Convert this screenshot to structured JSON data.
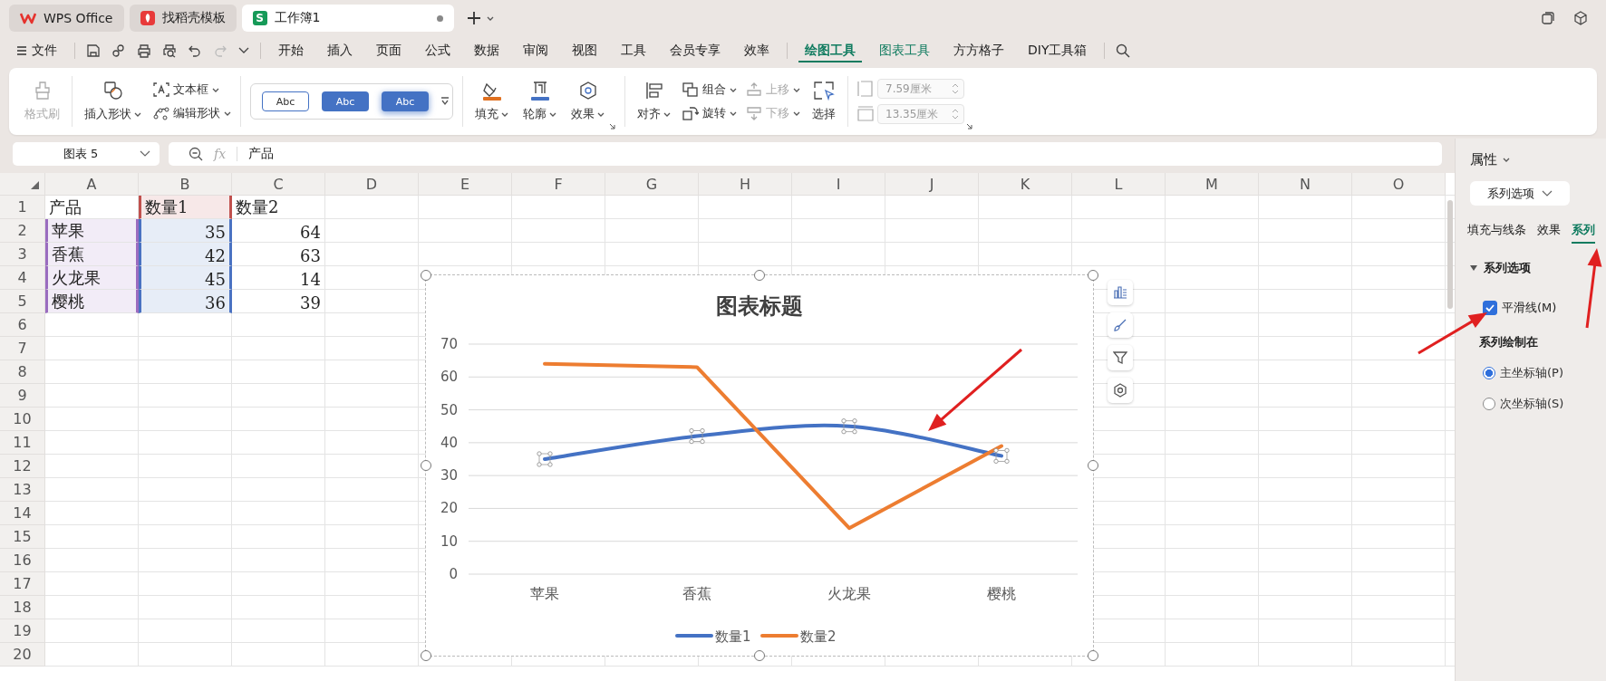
{
  "tabs": [
    {
      "label": "WPS Office",
      "kind": "wps",
      "selected": false,
      "modified": false
    },
    {
      "label": "找稻壳模板",
      "kind": "docer",
      "selected": false,
      "modified": false
    },
    {
      "label": "工作簿1",
      "kind": "sheet",
      "badge": "S",
      "selected": true,
      "modified": true
    }
  ],
  "menu": {
    "file": "文件",
    "items": [
      {
        "label": "开始",
        "selected": false,
        "contextual": false
      },
      {
        "label": "插入",
        "selected": false,
        "contextual": false
      },
      {
        "label": "页面",
        "selected": false,
        "contextual": false
      },
      {
        "label": "公式",
        "selected": false,
        "contextual": false
      },
      {
        "label": "数据",
        "selected": false,
        "contextual": false
      },
      {
        "label": "审阅",
        "selected": false,
        "contextual": false
      },
      {
        "label": "视图",
        "selected": false,
        "contextual": false
      },
      {
        "label": "工具",
        "selected": false,
        "contextual": false
      },
      {
        "label": "会员专享",
        "selected": false,
        "contextual": false
      },
      {
        "label": "效率",
        "selected": false,
        "contextual": false
      },
      {
        "label": "绘图工具",
        "selected": true,
        "contextual": true
      },
      {
        "label": "图表工具",
        "selected": false,
        "contextual": true
      },
      {
        "label": "方方格子",
        "selected": false,
        "contextual": false
      },
      {
        "label": "DIY工具箱",
        "selected": false,
        "contextual": false
      }
    ]
  },
  "ribbon": {
    "format_painter": {
      "label": "格式刷",
      "disabled": true
    },
    "insert_shape": "插入形状",
    "text_box": "文本框",
    "edit_shape": "编辑形状",
    "style_samples": [
      {
        "label": "Abc",
        "kind": "outline"
      },
      {
        "label": "Abc",
        "kind": "filled"
      },
      {
        "label": "Abc",
        "kind": "glow"
      }
    ],
    "fill": "填充",
    "outline": "轮廓",
    "effect": "效果",
    "align": "对齐",
    "group": "组合",
    "rotate": "旋转",
    "bring_forward": {
      "label": "上移",
      "disabled": true
    },
    "send_backward": {
      "label": "下移",
      "disabled": true
    },
    "select": "选择",
    "height": {
      "value": "7.59厘米",
      "disabled": true
    },
    "width": {
      "value": "13.35厘米",
      "disabled": true
    }
  },
  "formula_bar": {
    "name_box": "图表 5",
    "fx": "fx",
    "formula": "产品"
  },
  "sheet": {
    "columns": [
      "A",
      "B",
      "C",
      "D",
      "E",
      "F",
      "G",
      "H",
      "I",
      "J",
      "K",
      "L",
      "M",
      "N",
      "O"
    ],
    "rows": [
      {
        "label": "1",
        "cells": [
          {
            "text": "产品",
            "kind": "text"
          },
          {
            "text": "数量1",
            "kind": "text",
            "color": "#c0504d"
          },
          {
            "text": "数量2",
            "kind": "text"
          }
        ]
      },
      {
        "label": "2",
        "cells": [
          {
            "text": "苹果",
            "kind": "text",
            "color": "#9a6cbf"
          },
          {
            "text": "35",
            "kind": "number",
            "color": "#4a72c2"
          },
          {
            "text": "64",
            "kind": "number"
          }
        ]
      },
      {
        "label": "3",
        "cells": [
          {
            "text": "香蕉",
            "kind": "text",
            "color": "#9a6cbf"
          },
          {
            "text": "42",
            "kind": "number",
            "color": "#4a72c2"
          },
          {
            "text": "63",
            "kind": "number"
          }
        ]
      },
      {
        "label": "4",
        "cells": [
          {
            "text": "火龙果",
            "kind": "text",
            "color": "#9a6cbf"
          },
          {
            "text": "45",
            "kind": "number",
            "color": "#4a72c2"
          },
          {
            "text": "14",
            "kind": "number"
          }
        ]
      },
      {
        "label": "5",
        "cells": [
          {
            "text": "樱桃",
            "kind": "text",
            "color": "#9a6cbf"
          },
          {
            "text": "36",
            "kind": "number",
            "color": "#4a72c2"
          },
          {
            "text": "39",
            "kind": "number"
          }
        ]
      },
      {
        "label": "6",
        "cells": []
      },
      {
        "label": "7",
        "cells": []
      },
      {
        "label": "8",
        "cells": []
      },
      {
        "label": "9",
        "cells": []
      },
      {
        "label": "10",
        "cells": []
      },
      {
        "label": "11",
        "cells": []
      },
      {
        "label": "12",
        "cells": []
      },
      {
        "label": "13",
        "cells": []
      },
      {
        "label": "14",
        "cells": []
      },
      {
        "label": "15",
        "cells": []
      },
      {
        "label": "16",
        "cells": []
      },
      {
        "label": "17",
        "cells": []
      },
      {
        "label": "18",
        "cells": []
      },
      {
        "label": "19",
        "cells": []
      },
      {
        "label": "20",
        "cells": []
      }
    ]
  },
  "chart": {
    "chart_data": {
      "type": "line",
      "title": "图表标题",
      "categories": [
        "苹果",
        "香蕉",
        "火龙果",
        "樱桃"
      ],
      "series": [
        {
          "name": "数量1",
          "color": "#4472c4",
          "values": [
            35,
            42,
            45,
            36
          ],
          "marker": "square"
        },
        {
          "name": "数量2",
          "color": "#ed7d31",
          "values": [
            64,
            63,
            14,
            39
          ]
        }
      ],
      "ylim": [
        0,
        70
      ],
      "yticks": [
        0,
        10,
        20,
        30,
        40,
        50,
        60,
        70
      ],
      "grid": true,
      "legend": "bottom"
    }
  },
  "panel": {
    "title": "属性",
    "dropdown": "系列选项",
    "tabs": [
      {
        "label": "填充与线条",
        "selected": false
      },
      {
        "label": "效果",
        "selected": false
      },
      {
        "label": "系列",
        "selected": true
      }
    ],
    "section": {
      "label": "系列选项",
      "expanded": true
    },
    "smooth_line": {
      "label": "平滑线(M)",
      "checked": true
    },
    "plot_on_label": "系列绘制在",
    "axis_options": [
      {
        "label": "主坐标轴(P)",
        "selected": true
      },
      {
        "label": "次坐标轴(S)",
        "selected": false
      }
    ]
  }
}
